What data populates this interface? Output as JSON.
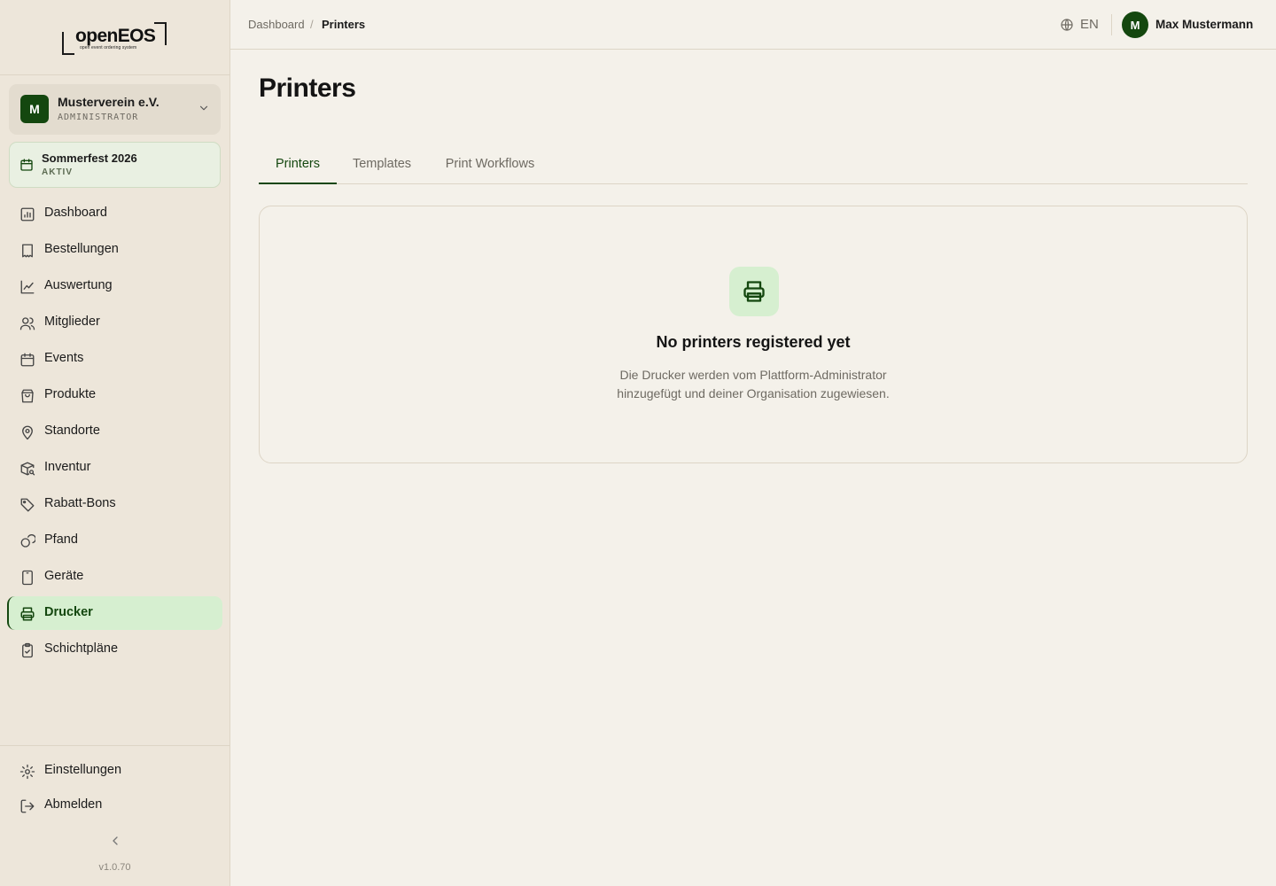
{
  "brand": {
    "name": "openEOS",
    "tagline": "open event ordering system"
  },
  "organization": {
    "initial": "M",
    "name": "Musterverein e.V.",
    "role": "ADMINISTRATOR"
  },
  "event": {
    "name": "Sommerfest 2026",
    "status": "AKTIV"
  },
  "nav": {
    "items": [
      {
        "label": "Dashboard",
        "icon": "chart-icon"
      },
      {
        "label": "Bestellungen",
        "icon": "receipt-icon"
      },
      {
        "label": "Auswertung",
        "icon": "trend-icon"
      },
      {
        "label": "Mitglieder",
        "icon": "users-icon"
      },
      {
        "label": "Events",
        "icon": "calendar-icon"
      },
      {
        "label": "Produkte",
        "icon": "shopping-bag-icon"
      },
      {
        "label": "Standorte",
        "icon": "map-pin-icon"
      },
      {
        "label": "Inventur",
        "icon": "package-search-icon"
      },
      {
        "label": "Rabatt-Bons",
        "icon": "tag-icon"
      },
      {
        "label": "Pfand",
        "icon": "coins-icon"
      },
      {
        "label": "Geräte",
        "icon": "tablet-icon"
      },
      {
        "label": "Drucker",
        "icon": "printer-icon",
        "active": true
      },
      {
        "label": "Schichtpläne",
        "icon": "clipboard-check-icon"
      }
    ],
    "settings_label": "Einstellungen",
    "logout_label": "Abmelden",
    "version": "v1.0.70"
  },
  "header": {
    "breadcrumb_home": "Dashboard",
    "breadcrumb_separator": "/",
    "breadcrumb_current": "Printers",
    "language": "EN",
    "user_initial": "M",
    "user_name": "Max Mustermann"
  },
  "page": {
    "title": "Printers",
    "tabs": [
      {
        "label": "Printers",
        "active": true
      },
      {
        "label": "Templates"
      },
      {
        "label": "Print Workflows"
      }
    ],
    "empty_state": {
      "title": "No printers registered yet",
      "description_line1": "Die Drucker werden vom Plattform-Administrator",
      "description_line2": "hinzugefügt und deiner Organisation zugewiesen."
    }
  },
  "colors": {
    "accent": "#14470f",
    "accent_light": "#d6efd0",
    "background": "#f4f1ea",
    "sidebar": "#ede6da"
  }
}
